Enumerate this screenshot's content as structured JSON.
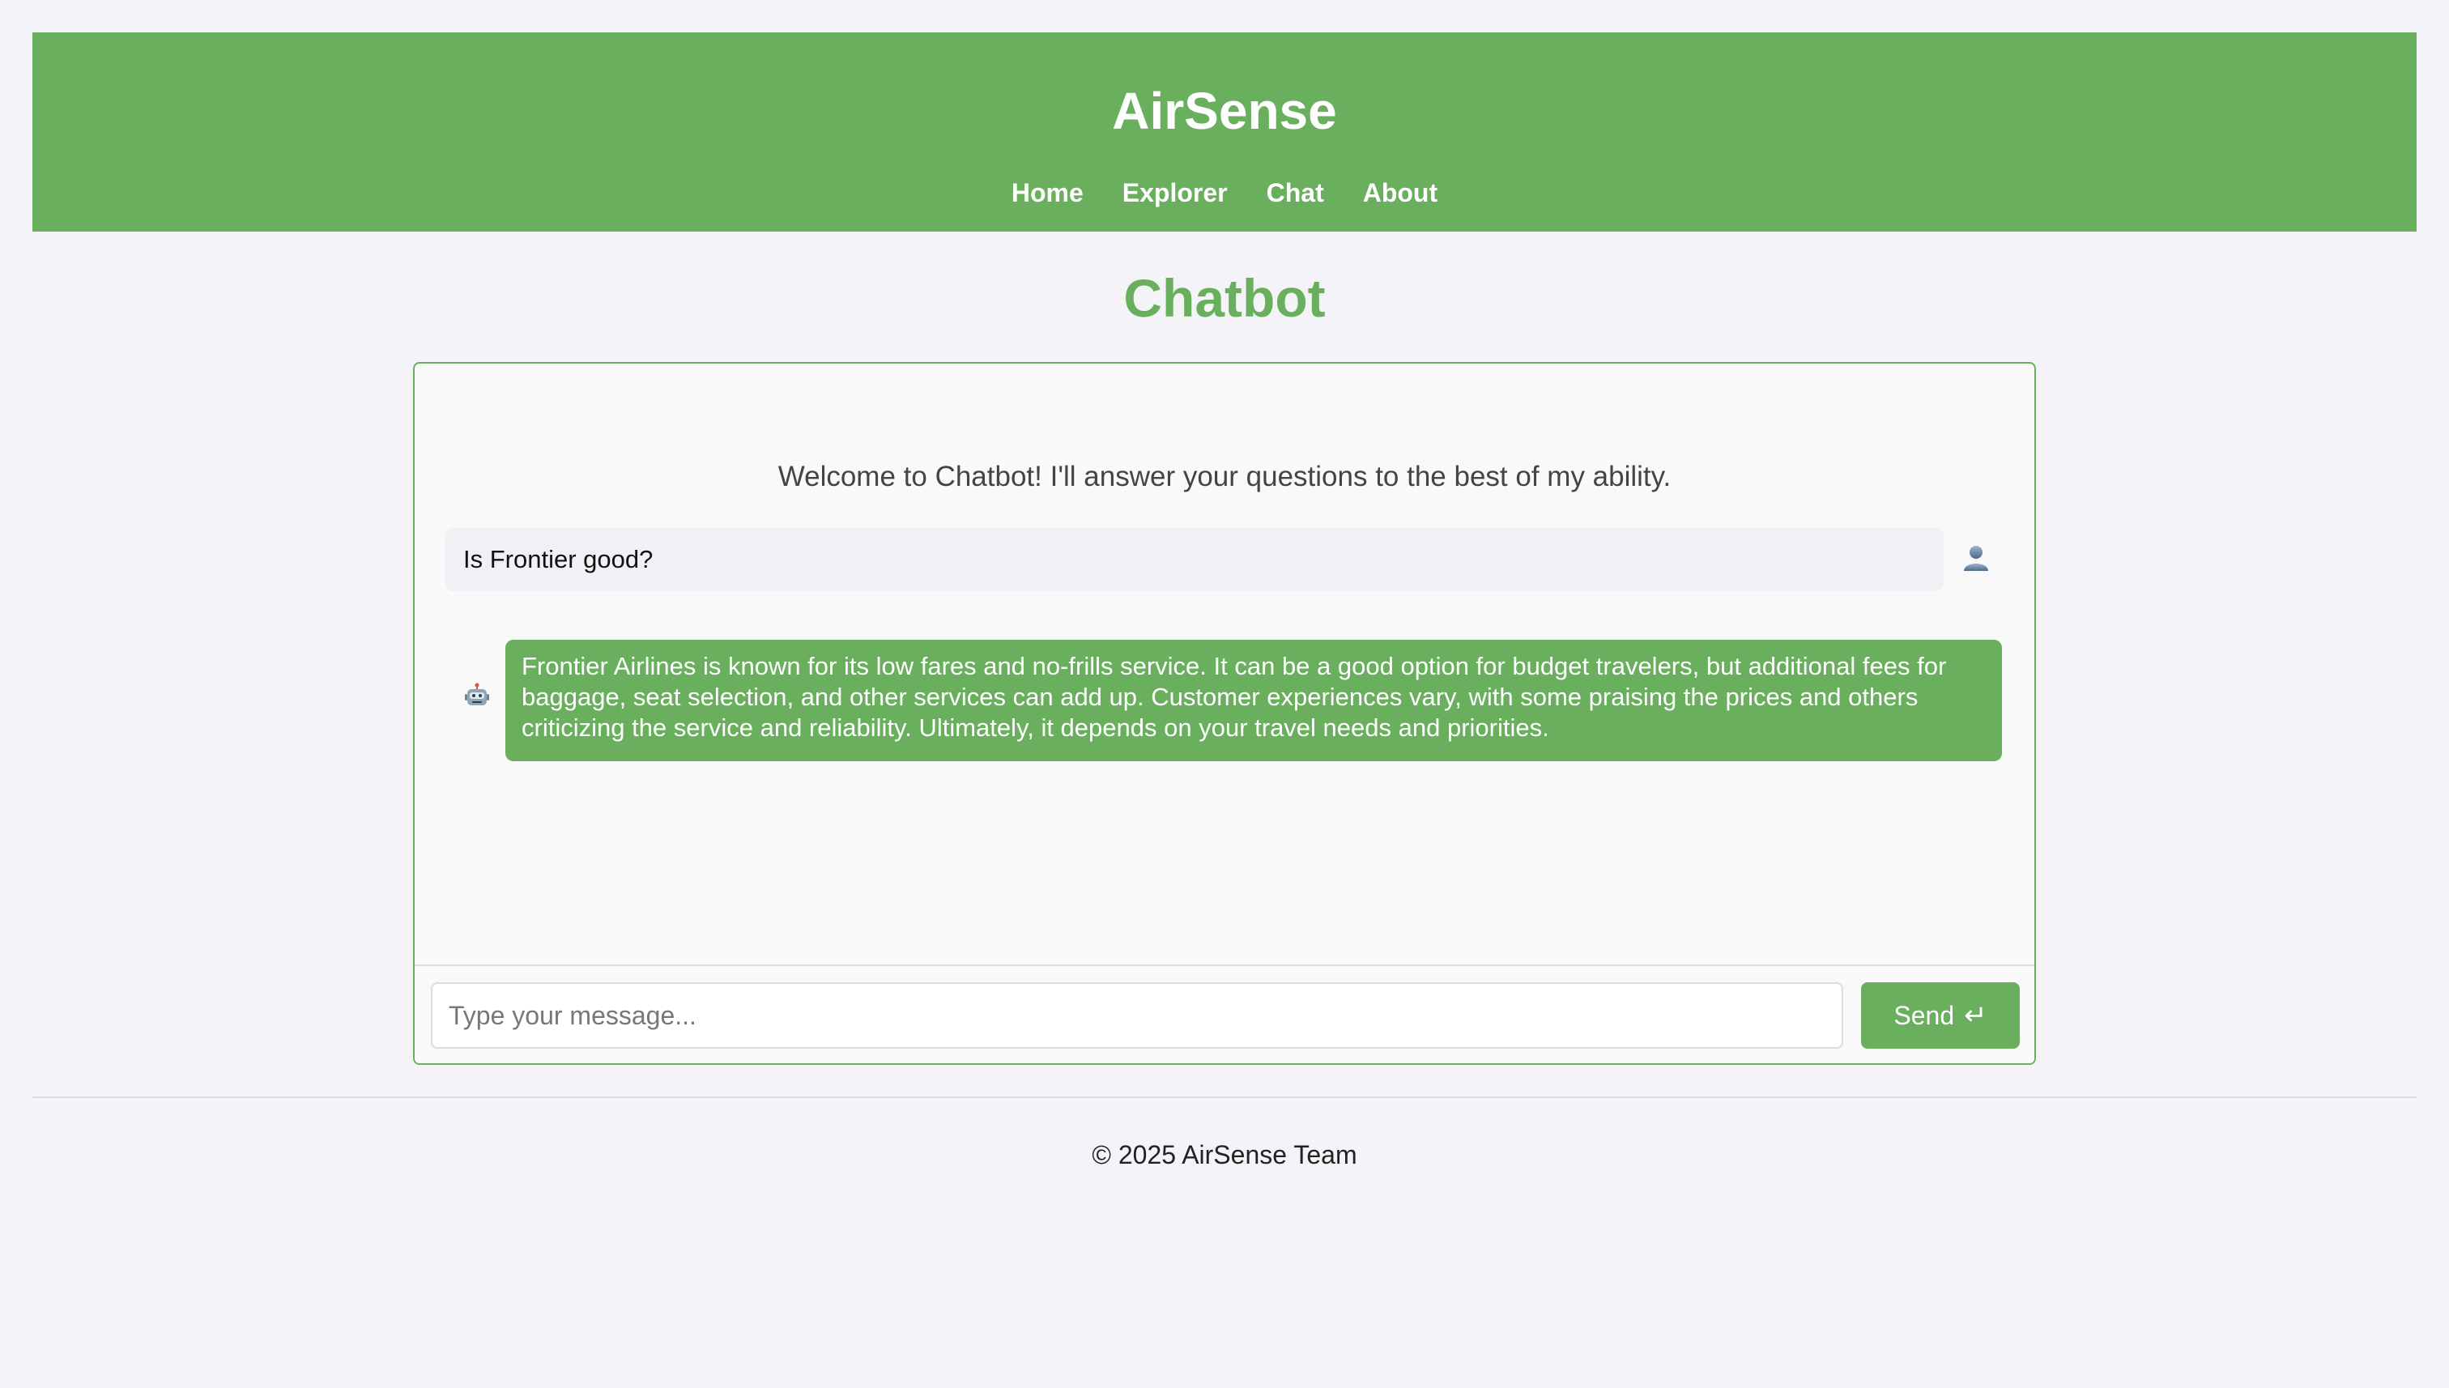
{
  "header": {
    "title": "AirSense",
    "nav": [
      "Home",
      "Explorer",
      "Chat",
      "About"
    ]
  },
  "page": {
    "title": "Chatbot"
  },
  "chat": {
    "welcome": "Welcome to Chatbot! I'll answer your questions to the best of my ability.",
    "messages": [
      {
        "role": "user",
        "text": "Is Frontier good?",
        "icon": "user-avatar-icon"
      },
      {
        "role": "bot",
        "text": "Frontier Airlines is known for its low fares and no-frills service. It can be a good option for budget travelers, but additional fees for baggage, seat selection, and other services can add up. Customer experiences vary, with some praising the prices and others criticizing the service and reliability. Ultimately, it depends on your travel needs and priorities.",
        "icon": "robot-icon"
      }
    ],
    "input": {
      "value": "",
      "placeholder": "Type your message..."
    },
    "send_label": "Send",
    "send_icon": "enter-icon"
  },
  "footer": {
    "text": "© 2025 AirSense Team"
  },
  "colors": {
    "accent": "#6aaf5e",
    "background": "#f4f4f8"
  }
}
